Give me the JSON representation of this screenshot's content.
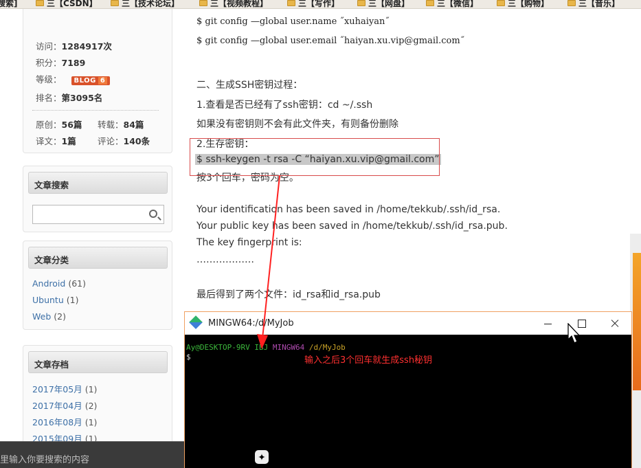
{
  "bookmarks": [
    {
      "label": "搜索]"
    },
    {
      "label": "三【CSDN】"
    },
    {
      "label": "三【技术论坛】"
    },
    {
      "label": "三【视频教程】"
    },
    {
      "label": "三【写作】"
    },
    {
      "label": "三【网盘】"
    },
    {
      "label": "三【微信】"
    },
    {
      "label": "三【购物】"
    },
    {
      "label": "三【音乐】"
    }
  ],
  "profile": {
    "visits_label": "访问：",
    "visits_value": "1284917次",
    "points_label": "积分：",
    "points_value": "7189",
    "level_label": "等级：",
    "level_badge": "BLOG",
    "level_value": "6",
    "rank_label": "排名：",
    "rank_value": "第3095名",
    "original_label": "原创：",
    "original_value": "56篇",
    "repost_label": "转载：",
    "repost_value": "84篇",
    "translate_label": "译文：",
    "translate_value": "1篇",
    "comments_label": "评论：",
    "comments_value": "140条"
  },
  "search_panel": {
    "title": "文章搜索",
    "placeholder": ""
  },
  "category_panel": {
    "title": "文章分类",
    "items": [
      {
        "name": "Android",
        "count": "(61)"
      },
      {
        "name": "Ubuntu",
        "count": "(1)"
      },
      {
        "name": "Web",
        "count": "(2)"
      }
    ]
  },
  "archive_panel": {
    "title": "文章存档",
    "items": [
      {
        "name": "2017年05月",
        "count": "(1)"
      },
      {
        "name": "2017年04月",
        "count": "(2)"
      },
      {
        "name": "2016年08月",
        "count": "(1)"
      },
      {
        "name": "2015年09月",
        "count": "(1)"
      }
    ]
  },
  "bottom_search": {
    "placeholder": "里输入你要搜索的内容"
  },
  "article": {
    "code1": "$ git config —global user.name ˝xuhaiyan˝",
    "code2": "$ git config —global user.email ˝haiyan.xu.vip@gmail.com˝",
    "section2": "二、生成SSH密钥过程：",
    "step1": "1.查看是否已经有了ssh密钥：cd ~/.ssh",
    "step1_note": "如果没有密钥则不会有此文件夹，有则备份删除",
    "step2": "2.生存密钥：",
    "keygen_cmd": "$ ssh-keygen -t rsa -C “haiyan.xu.vip@gmail.com”",
    "step2_note": "按3个回车，密码为空。",
    "out1": "Your identification has been saved in /home/tekkub/.ssh/id_rsa.",
    "out2": "Your public key has been saved in /home/tekkub/.ssh/id_rsa.pub.",
    "out3": "The key fingerprint is:",
    "out4": "………………",
    "result": "最后得到了两个文件：id_rsa和id_rsa.pub"
  },
  "terminal": {
    "title": "MINGW64:/d/MyJob",
    "prompt_user": "Ay@DESKTOP-9RV",
    "prompt_host_tail": "IBJ",
    "prompt_env": "MINGW64",
    "prompt_path": "/d/MyJob",
    "prompt_symbol": "$",
    "annotation": "输入之后3个回车就生成ssh秘钥"
  }
}
